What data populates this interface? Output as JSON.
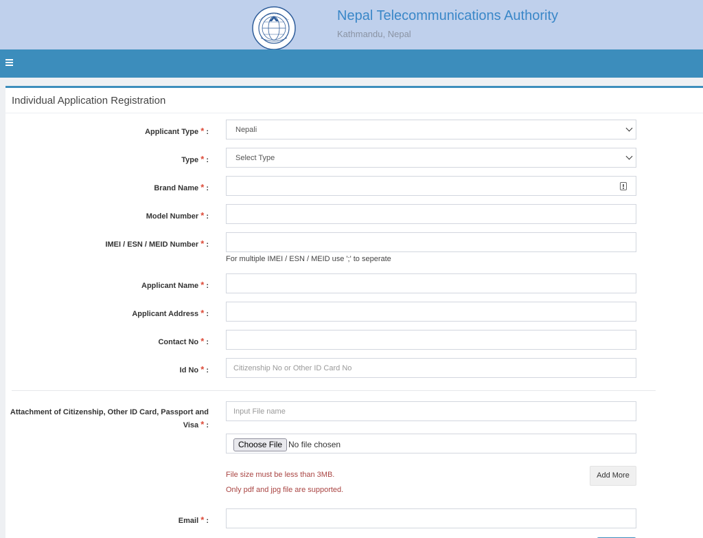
{
  "header": {
    "title": "Nepal Telecommunications Authority",
    "subtitle": "Kathmandu, Nepal",
    "logo_text": "नेपाल दूरसञ्चार प्राधिकरण · NEPAL TELECOMMUNICATIONS AUTHORITY",
    "colors": {
      "banner": "#bfd0ec",
      "navbar": "#3c8dbc",
      "title": "#3a87c8"
    }
  },
  "navbar": {
    "menu_icon": "hamburger-menu-icon"
  },
  "form": {
    "title": "Individual Application Registration",
    "required_marker": "*",
    "label_suffix": " :",
    "fields": {
      "applicant_type": {
        "label": "Applicant Type",
        "value": "Nepali"
      },
      "type": {
        "label": "Type",
        "value": "Select Type"
      },
      "brand_name": {
        "label": "Brand Name",
        "value": "",
        "icon": "autofill-info-icon"
      },
      "model_number": {
        "label": "Model Number",
        "value": ""
      },
      "imei": {
        "label": "IMEI / ESN / MEID Number",
        "value": "",
        "help": "For multiple IMEI / ESN / MEID use ';' to seperate"
      },
      "applicant_name": {
        "label": "Applicant Name",
        "value": ""
      },
      "applicant_address": {
        "label": "Applicant Address",
        "value": ""
      },
      "contact_no": {
        "label": "Contact No",
        "value": ""
      },
      "id_no": {
        "label": "Id No",
        "value": "",
        "placeholder": "Citizenship No or Other ID Card No"
      },
      "attachment": {
        "label": "Attachment of Citizenship, Other ID Card, Passport and Visa",
        "file_name_placeholder": "Input File name",
        "choose_file_label": "Choose File",
        "file_status": "No file chosen",
        "size_note": "File size must be less than 3MB.",
        "type_note": "Only pdf and jpg file are supported.",
        "add_more_label": "Add More"
      },
      "email": {
        "label": "Email",
        "value": ""
      }
    }
  }
}
